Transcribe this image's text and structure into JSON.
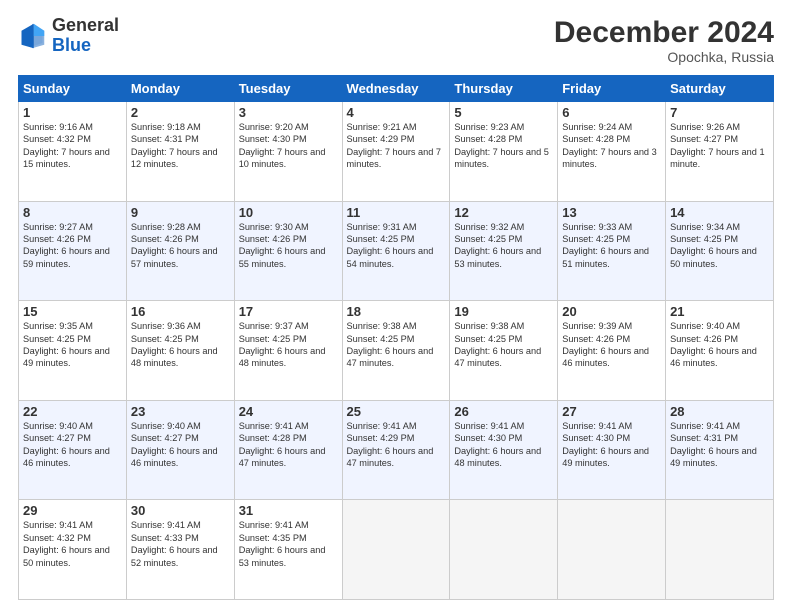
{
  "header": {
    "logo_general": "General",
    "logo_blue": "Blue",
    "month_title": "December 2024",
    "location": "Opochka, Russia"
  },
  "days_of_week": [
    "Sunday",
    "Monday",
    "Tuesday",
    "Wednesday",
    "Thursday",
    "Friday",
    "Saturday"
  ],
  "weeks": [
    [
      {
        "day": "1",
        "sunrise": "Sunrise: 9:16 AM",
        "sunset": "Sunset: 4:32 PM",
        "daylight": "Daylight: 7 hours and 15 minutes."
      },
      {
        "day": "2",
        "sunrise": "Sunrise: 9:18 AM",
        "sunset": "Sunset: 4:31 PM",
        "daylight": "Daylight: 7 hours and 12 minutes."
      },
      {
        "day": "3",
        "sunrise": "Sunrise: 9:20 AM",
        "sunset": "Sunset: 4:30 PM",
        "daylight": "Daylight: 7 hours and 10 minutes."
      },
      {
        "day": "4",
        "sunrise": "Sunrise: 9:21 AM",
        "sunset": "Sunset: 4:29 PM",
        "daylight": "Daylight: 7 hours and 7 minutes."
      },
      {
        "day": "5",
        "sunrise": "Sunrise: 9:23 AM",
        "sunset": "Sunset: 4:28 PM",
        "daylight": "Daylight: 7 hours and 5 minutes."
      },
      {
        "day": "6",
        "sunrise": "Sunrise: 9:24 AM",
        "sunset": "Sunset: 4:28 PM",
        "daylight": "Daylight: 7 hours and 3 minutes."
      },
      {
        "day": "7",
        "sunrise": "Sunrise: 9:26 AM",
        "sunset": "Sunset: 4:27 PM",
        "daylight": "Daylight: 7 hours and 1 minute."
      }
    ],
    [
      {
        "day": "8",
        "sunrise": "Sunrise: 9:27 AM",
        "sunset": "Sunset: 4:26 PM",
        "daylight": "Daylight: 6 hours and 59 minutes."
      },
      {
        "day": "9",
        "sunrise": "Sunrise: 9:28 AM",
        "sunset": "Sunset: 4:26 PM",
        "daylight": "Daylight: 6 hours and 57 minutes."
      },
      {
        "day": "10",
        "sunrise": "Sunrise: 9:30 AM",
        "sunset": "Sunset: 4:26 PM",
        "daylight": "Daylight: 6 hours and 55 minutes."
      },
      {
        "day": "11",
        "sunrise": "Sunrise: 9:31 AM",
        "sunset": "Sunset: 4:25 PM",
        "daylight": "Daylight: 6 hours and 54 minutes."
      },
      {
        "day": "12",
        "sunrise": "Sunrise: 9:32 AM",
        "sunset": "Sunset: 4:25 PM",
        "daylight": "Daylight: 6 hours and 53 minutes."
      },
      {
        "day": "13",
        "sunrise": "Sunrise: 9:33 AM",
        "sunset": "Sunset: 4:25 PM",
        "daylight": "Daylight: 6 hours and 51 minutes."
      },
      {
        "day": "14",
        "sunrise": "Sunrise: 9:34 AM",
        "sunset": "Sunset: 4:25 PM",
        "daylight": "Daylight: 6 hours and 50 minutes."
      }
    ],
    [
      {
        "day": "15",
        "sunrise": "Sunrise: 9:35 AM",
        "sunset": "Sunset: 4:25 PM",
        "daylight": "Daylight: 6 hours and 49 minutes."
      },
      {
        "day": "16",
        "sunrise": "Sunrise: 9:36 AM",
        "sunset": "Sunset: 4:25 PM",
        "daylight": "Daylight: 6 hours and 48 minutes."
      },
      {
        "day": "17",
        "sunrise": "Sunrise: 9:37 AM",
        "sunset": "Sunset: 4:25 PM",
        "daylight": "Daylight: 6 hours and 48 minutes."
      },
      {
        "day": "18",
        "sunrise": "Sunrise: 9:38 AM",
        "sunset": "Sunset: 4:25 PM",
        "daylight": "Daylight: 6 hours and 47 minutes."
      },
      {
        "day": "19",
        "sunrise": "Sunrise: 9:38 AM",
        "sunset": "Sunset: 4:25 PM",
        "daylight": "Daylight: 6 hours and 47 minutes."
      },
      {
        "day": "20",
        "sunrise": "Sunrise: 9:39 AM",
        "sunset": "Sunset: 4:26 PM",
        "daylight": "Daylight: 6 hours and 46 minutes."
      },
      {
        "day": "21",
        "sunrise": "Sunrise: 9:40 AM",
        "sunset": "Sunset: 4:26 PM",
        "daylight": "Daylight: 6 hours and 46 minutes."
      }
    ],
    [
      {
        "day": "22",
        "sunrise": "Sunrise: 9:40 AM",
        "sunset": "Sunset: 4:27 PM",
        "daylight": "Daylight: 6 hours and 46 minutes."
      },
      {
        "day": "23",
        "sunrise": "Sunrise: 9:40 AM",
        "sunset": "Sunset: 4:27 PM",
        "daylight": "Daylight: 6 hours and 46 minutes."
      },
      {
        "day": "24",
        "sunrise": "Sunrise: 9:41 AM",
        "sunset": "Sunset: 4:28 PM",
        "daylight": "Daylight: 6 hours and 47 minutes."
      },
      {
        "day": "25",
        "sunrise": "Sunrise: 9:41 AM",
        "sunset": "Sunset: 4:29 PM",
        "daylight": "Daylight: 6 hours and 47 minutes."
      },
      {
        "day": "26",
        "sunrise": "Sunrise: 9:41 AM",
        "sunset": "Sunset: 4:30 PM",
        "daylight": "Daylight: 6 hours and 48 minutes."
      },
      {
        "day": "27",
        "sunrise": "Sunrise: 9:41 AM",
        "sunset": "Sunset: 4:30 PM",
        "daylight": "Daylight: 6 hours and 49 minutes."
      },
      {
        "day": "28",
        "sunrise": "Sunrise: 9:41 AM",
        "sunset": "Sunset: 4:31 PM",
        "daylight": "Daylight: 6 hours and 49 minutes."
      }
    ],
    [
      {
        "day": "29",
        "sunrise": "Sunrise: 9:41 AM",
        "sunset": "Sunset: 4:32 PM",
        "daylight": "Daylight: 6 hours and 50 minutes."
      },
      {
        "day": "30",
        "sunrise": "Sunrise: 9:41 AM",
        "sunset": "Sunset: 4:33 PM",
        "daylight": "Daylight: 6 hours and 52 minutes."
      },
      {
        "day": "31",
        "sunrise": "Sunrise: 9:41 AM",
        "sunset": "Sunset: 4:35 PM",
        "daylight": "Daylight: 6 hours and 53 minutes."
      },
      null,
      null,
      null,
      null
    ]
  ]
}
